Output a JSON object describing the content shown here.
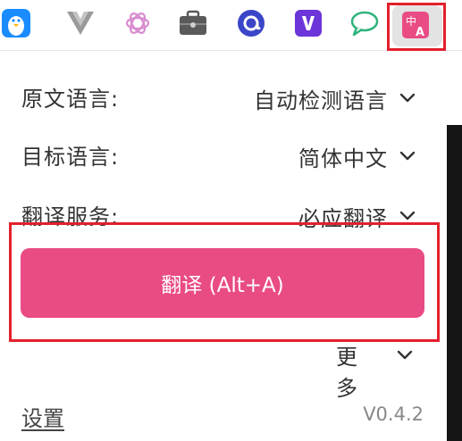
{
  "toolbar": {
    "extensions": [
      {
        "icon": "penguin-icon",
        "color": "#1a8cff"
      },
      {
        "icon": "vue-devtools-icon",
        "color": "#9a9a9a"
      },
      {
        "icon": "openai-icon",
        "color": "#d98bd0"
      },
      {
        "icon": "briefcase-icon",
        "color": "#5a5a5a"
      },
      {
        "icon": "at-mail-icon",
        "color": "#3b45c8"
      },
      {
        "icon": "v-extension-icon",
        "color": "#6b35d9"
      },
      {
        "icon": "chat-bubble-icon",
        "color": "#2fb37b"
      },
      {
        "icon": "translate-icon",
        "color": "#e94b85",
        "glyph_top": "中",
        "glyph_bottom": "A"
      }
    ]
  },
  "popup": {
    "source_language": {
      "label": "原文语言:",
      "value": "自动检测语言"
    },
    "target_language": {
      "label": "目标语言:",
      "value": "简体中文"
    },
    "translation_service": {
      "label": "翻译服务:",
      "value": "必应翻译"
    },
    "translate_button": "翻译 (Alt+A)",
    "more": "更多",
    "settings": "设置",
    "version": "V0.4.2"
  },
  "colors": {
    "accent": "#e94b85",
    "highlight": "#e2202c"
  }
}
